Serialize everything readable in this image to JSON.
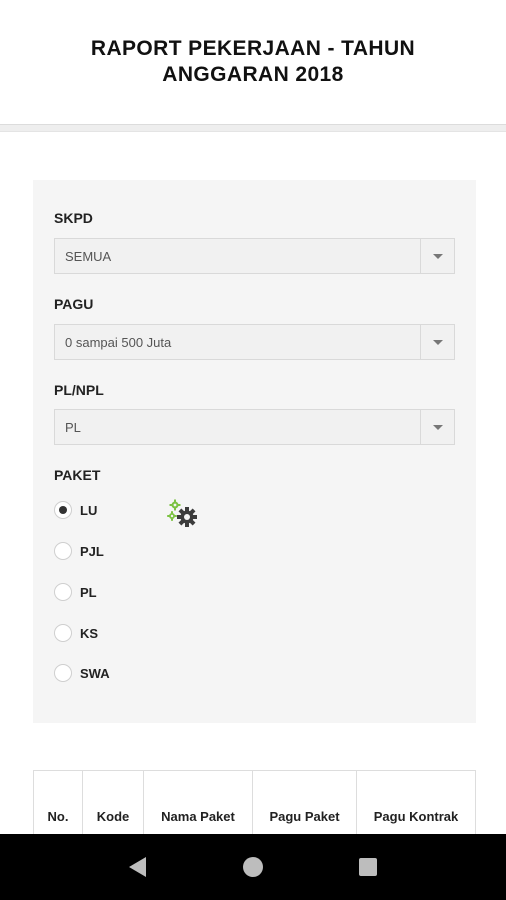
{
  "header": {
    "title": "RAPORT PEKERJAAN - TAHUN ANGGARAN 2018"
  },
  "form": {
    "skpd": {
      "label": "SKPD",
      "value": "SEMUA"
    },
    "pagu": {
      "label": "PAGU",
      "value": "0 sampai 500 Juta"
    },
    "plnpl": {
      "label": "PL/NPL",
      "value": "PL"
    },
    "paket": {
      "label": "PAKET",
      "options": [
        "LU",
        "PJL",
        "PL",
        "KS",
        "SWA"
      ],
      "selected": "LU"
    }
  },
  "table": {
    "headers": [
      "No.",
      "Kode",
      "Nama Paket",
      "Pagu Paket",
      "Pagu Kontrak"
    ]
  },
  "icons": {
    "loading": "gears-icon",
    "nav_back": "back-triangle-icon",
    "nav_home": "home-circle-icon",
    "nav_recent": "recent-square-icon"
  },
  "colors": {
    "gear_dark": "#3c3c3c",
    "gear_green": "#7cc242"
  }
}
